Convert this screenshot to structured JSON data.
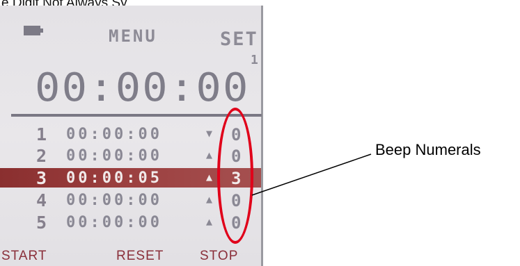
{
  "caption": "e Digit Not Always Sy",
  "header": {
    "battery_icon": "battery-icon",
    "menu_label": "MENU",
    "set_label": "SET",
    "set_number": "1"
  },
  "display": {
    "main_time": "00:00:00"
  },
  "rows": [
    {
      "index": "1",
      "time": "00:00:00",
      "arrow": "▼",
      "beep": "0",
      "selected": false
    },
    {
      "index": "2",
      "time": "00:00:00",
      "arrow": "▲",
      "beep": "0",
      "selected": false
    },
    {
      "index": "3",
      "time": "00:00:05",
      "arrow": "▲",
      "beep": "3",
      "selected": true
    },
    {
      "index": "4",
      "time": "00:00:00",
      "arrow": "▲",
      "beep": "0",
      "selected": false
    },
    {
      "index": "5",
      "time": "00:00:00",
      "arrow": "▲",
      "beep": "0",
      "selected": false
    }
  ],
  "softkeys": {
    "start": "START",
    "reset": "RESET",
    "stop": "STOP"
  },
  "annotation": {
    "label": "Beep Numerals",
    "color": "#e0001a"
  },
  "colors": {
    "lcd_background": "#e6e4e8",
    "lcd_text": "#8a8894",
    "selected_row": "#9c4040",
    "softkey_text": "#8a2f3a"
  }
}
